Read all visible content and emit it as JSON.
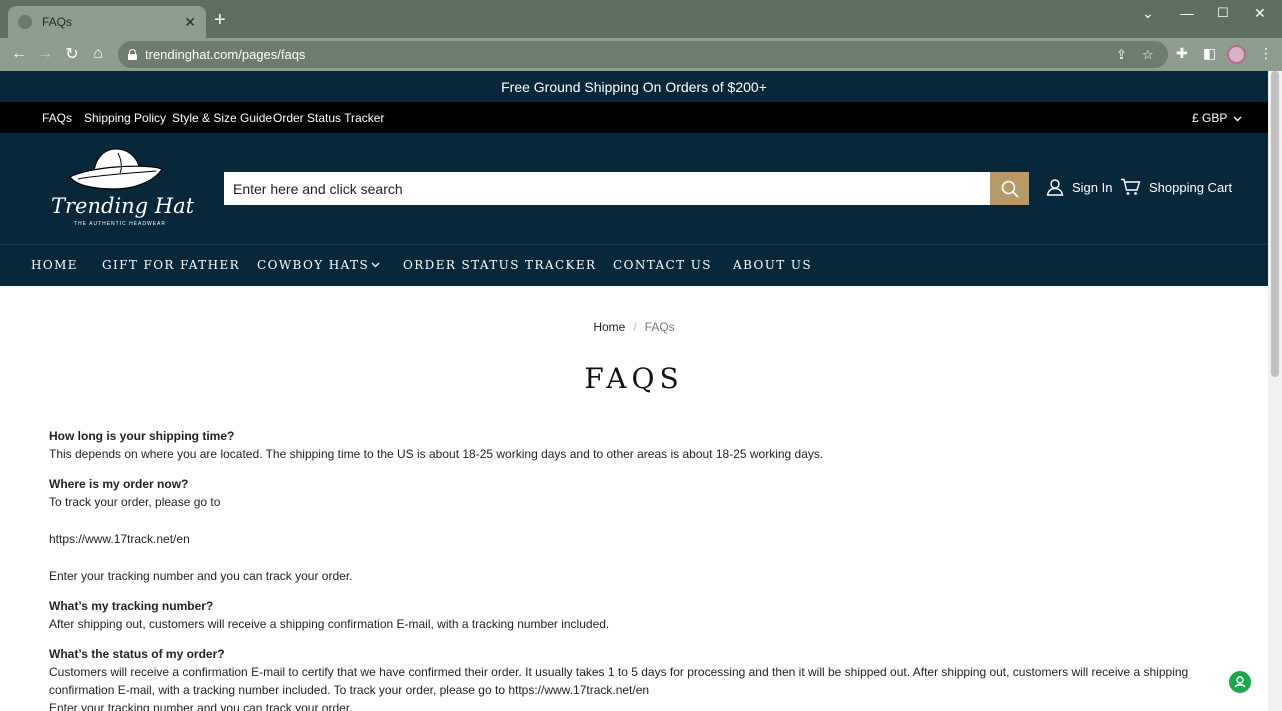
{
  "browser": {
    "tab_title": "FAQs",
    "url": "trendinghat.com/pages/faqs"
  },
  "announcement": "Free Ground Shipping On Orders of $200+",
  "top_menu": {
    "items": [
      "FAQs",
      "Shipping Policy",
      "Style & Size Guide",
      "Order Status Tracker"
    ],
    "currency": "£ GBP"
  },
  "header": {
    "logo_text": "Trending Hat",
    "logo_tagline": "THE AUTHENTIC HEADWEAR",
    "search_placeholder": "Enter here and click search",
    "sign_in": "Sign In",
    "cart": "Shopping Cart"
  },
  "main_nav": [
    "HOME",
    "GIFT FOR FATHER",
    "COWBOY HATS",
    "ORDER STATUS TRACKER",
    "CONTACT US",
    "ABOUT US"
  ],
  "breadcrumb": {
    "home": "Home",
    "separator": "/",
    "current": "FAQs"
  },
  "page_title": "FAQS",
  "faqs": [
    {
      "question": "How long is your shipping time?",
      "answer": "This depends on where you are located. The shipping time to the US is about 18-25 working days and to other areas is about 18-25 working days."
    },
    {
      "question": "Where is my order now?",
      "answer_intro": "To track your order, please go to",
      "link": "https://www.17track.net/en",
      "answer_outro": "Enter your tracking number and you can track your order."
    },
    {
      "question": "What’s my tracking number?",
      "answer": "After shipping out, customers will receive a shipping confirmation E-mail, with a tracking number included."
    },
    {
      "question": "What’s the status of my order?",
      "answer": "Customers will receive a confirmation E-mail to certify that we have confirmed their order. It usually takes 1 to 5 days for processing and then it will be shipped out. After shipping out, customers will receive a shipping confirmation E-mail, with a tracking number included. To track your order, please go to https://www.17track.net/en",
      "answer_tail": "Enter your tracking number and you can track your order."
    }
  ],
  "colors": {
    "header_bg": "#07273a",
    "top_menu_bg": "#000000",
    "search_button": "#b89968",
    "browser_chrome": "#8e9c8e",
    "chat_widget": "#19a94a"
  }
}
